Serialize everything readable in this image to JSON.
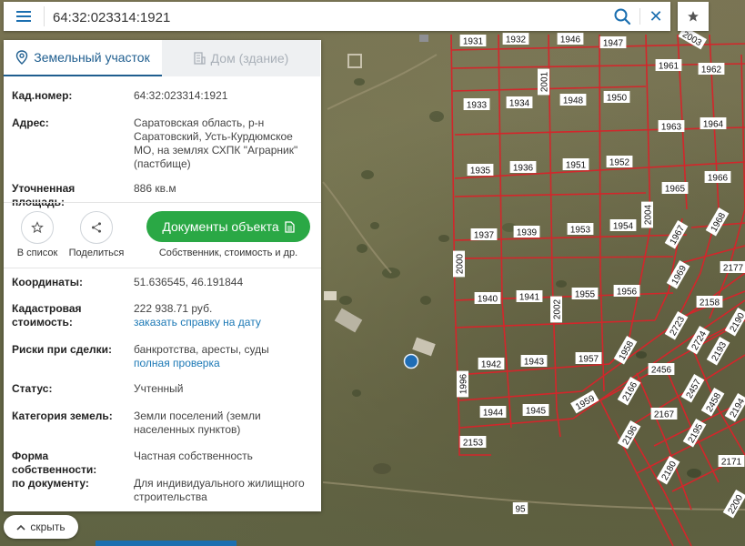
{
  "search": {
    "value": "64:32:023314:1921"
  },
  "tabs": [
    {
      "label": "Земельный участок",
      "icon": "map-pin-icon",
      "active": true
    },
    {
      "label": "Дом (здание)",
      "icon": "building-icon",
      "active": false
    }
  ],
  "info": {
    "cadastral_number_label": "Кад.номер:",
    "cadastral_number": "64:32:023314:1921",
    "address_label": "Адрес:",
    "address": "Саратовская область, р-н Саратовский, Усть-Курдюмское МО, на землях СХПК \"Аграрник\" (пастбище)",
    "area_label": "Уточненная площадь:",
    "area": "886 кв.м"
  },
  "actions": {
    "add_to_list": "В список",
    "share": "Поделиться",
    "documents_button": "Документы объекта",
    "documents_sub": "Собственник, стоимость и др."
  },
  "details": {
    "coords_label": "Координаты:",
    "coords": "51.636545, 46.191844",
    "cost_label": "Кадастровая стоимость:",
    "cost": "222 938.71 руб.",
    "cost_link": "заказать справку на дату",
    "risks_label": "Риски при сделки:",
    "risks": "банкротства, аресты, суды",
    "risks_link": "полная проверка",
    "status_label": "Статус:",
    "status": "Учтенный",
    "category_label": "Категория земель:",
    "category": "Земли поселений (земли населенных пунктов)",
    "ownership_label": "Форма собственности:",
    "ownership": "Частная собственность",
    "usage_label": "по документу:",
    "usage": "Для индивидуального жилищного строительства"
  },
  "collapse_label": "скрыть",
  "map": {
    "parcel_color": "#d3262b",
    "marker_color": "#1f6db5",
    "parcel_labels": [
      "1931",
      "1932",
      "1946",
      "1947",
      "2003",
      "1961",
      "1962",
      "1933",
      "1934",
      "2001",
      "1948",
      "1950",
      "1963",
      "1964",
      "1935",
      "1936",
      "1951",
      "1952",
      "1965",
      "1966",
      "1937",
      "1939",
      "1953",
      "1954",
      "2004",
      "1967",
      "1968",
      "2000",
      "1940",
      "1941",
      "1955",
      "1956",
      "1969",
      "2177",
      "2158",
      "2002",
      "2190",
      "2723",
      "2724",
      "1942",
      "1943",
      "1957",
      "1958",
      "2456",
      "2193",
      "1996",
      "2457",
      "2458",
      "1944",
      "1945",
      "1959",
      "2166",
      "2167",
      "2195",
      "2194",
      "2153",
      "2196",
      "2180",
      "2171",
      "95",
      "2200"
    ]
  }
}
